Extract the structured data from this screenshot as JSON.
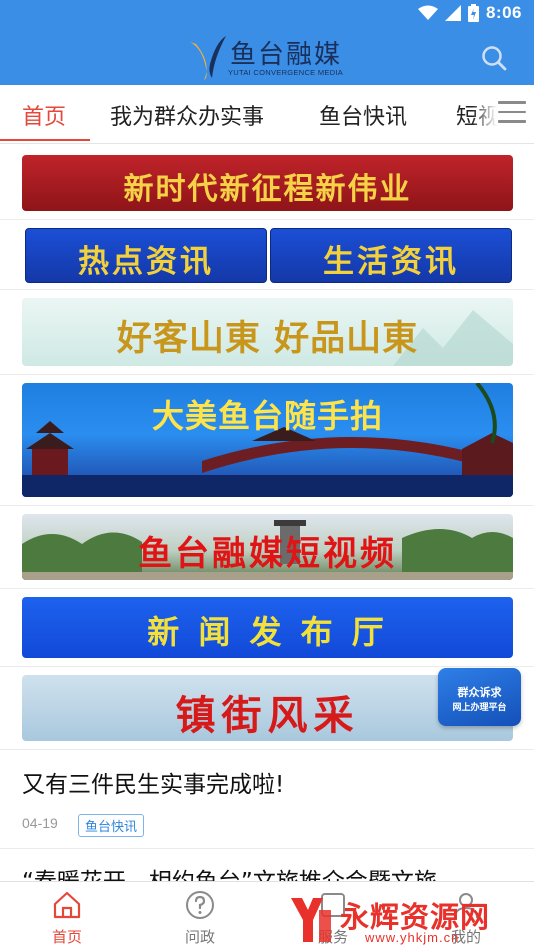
{
  "status_bar": {
    "time": "8:06"
  },
  "header": {
    "logo_cn": "鱼台融媒",
    "logo_en": "YUTAI CONVERGENCE MEDIA",
    "search_icon": "search-icon"
  },
  "tabs": [
    {
      "label": "首页",
      "active": true
    },
    {
      "label": "我为群众办实事",
      "active": false
    },
    {
      "label": "鱼台快讯",
      "active": false
    },
    {
      "label": "短视频",
      "active": false
    }
  ],
  "banners": {
    "b1": "新时代新征程新伟业",
    "b2a": "热点资讯",
    "b2b": "生活资讯",
    "b3": "好客山東 好品山東",
    "b4": "大美鱼台随手拍",
    "b5": "鱼台融媒短视频",
    "b6": "新 闻 发 布 厅",
    "b7": "镇街风采"
  },
  "float_badge": {
    "line1": "群众诉求",
    "line2": "网上办理平台"
  },
  "news": [
    {
      "title": "又有三件民生实事完成啦!",
      "date": "04-19",
      "tag": "鱼台快讯"
    },
    {
      "title": "“春暖花开，相约鱼台”文旅推介会暨文旅"
    }
  ],
  "bottom_nav": [
    {
      "label": "首页",
      "icon": "home-icon",
      "active": true
    },
    {
      "label": "问政",
      "icon": "question-icon",
      "active": false
    },
    {
      "label": "服务",
      "icon": "service-icon",
      "active": false
    },
    {
      "label": "我的",
      "icon": "user-icon",
      "active": false
    }
  ],
  "watermark": {
    "brand": "永辉资源网",
    "url": "www.yhkjm.cn"
  },
  "colors": {
    "primary": "#3a8ee6",
    "accent": "#e5473a"
  }
}
